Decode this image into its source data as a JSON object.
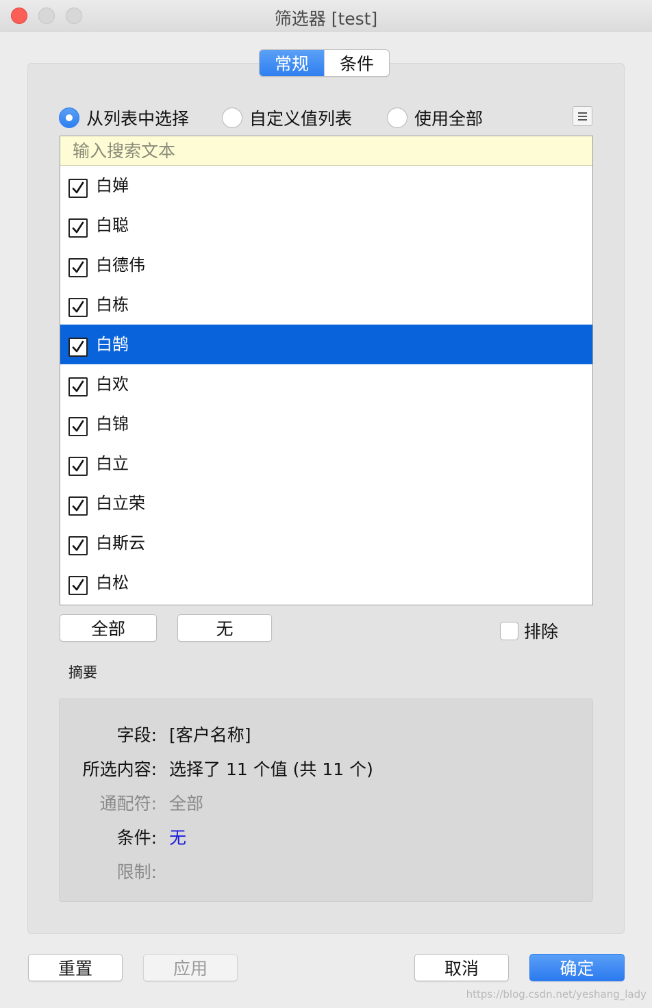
{
  "window": {
    "title": "筛选器 [test]"
  },
  "tabs": [
    {
      "label": "常规",
      "active": true
    },
    {
      "label": "条件",
      "active": false
    }
  ],
  "radio_options": [
    {
      "label": "从列表中选择",
      "selected": true
    },
    {
      "label": "自定义值列表",
      "selected": false
    },
    {
      "label": "使用全部",
      "selected": false
    }
  ],
  "search": {
    "placeholder": "输入搜索文本",
    "value": ""
  },
  "list_items": [
    {
      "label": "白婵",
      "checked": true
    },
    {
      "label": "白聪",
      "checked": true
    },
    {
      "label": "白德伟",
      "checked": true
    },
    {
      "label": "白栋",
      "checked": true
    },
    {
      "label": "白鹄",
      "checked": true,
      "highlighted": true
    },
    {
      "label": "白欢",
      "checked": true
    },
    {
      "label": "白锦",
      "checked": true
    },
    {
      "label": "白立",
      "checked": true
    },
    {
      "label": "白立荣",
      "checked": true
    },
    {
      "label": "白斯云",
      "checked": true
    },
    {
      "label": "白松",
      "checked": true
    }
  ],
  "list_buttons": {
    "all": "全部",
    "none": "无"
  },
  "exclude": {
    "label": "排除",
    "checked": false
  },
  "summary": {
    "heading": "摘要",
    "rows": [
      {
        "key": "字段:",
        "value": "[客户名称]",
        "style": "normal"
      },
      {
        "key": "所选内容:",
        "value": "选择了 11 个值 (共 11 个)",
        "style": "normal"
      },
      {
        "key": "通配符:",
        "value": "全部",
        "style": "gray"
      },
      {
        "key": "条件:",
        "value": "无",
        "style": "blue"
      },
      {
        "key": "限制:",
        "value": "",
        "style": "gray"
      }
    ]
  },
  "footer": {
    "reset": "重置",
    "apply": "应用",
    "cancel": "取消",
    "ok": "确定"
  },
  "watermark": "https://blog.csdn.net/yeshang_lady",
  "colors": {
    "accent": "#2f7ff0",
    "selection": "#0963da",
    "search_bg": "#fdfcd5",
    "condition_link": "#1a1adc"
  }
}
